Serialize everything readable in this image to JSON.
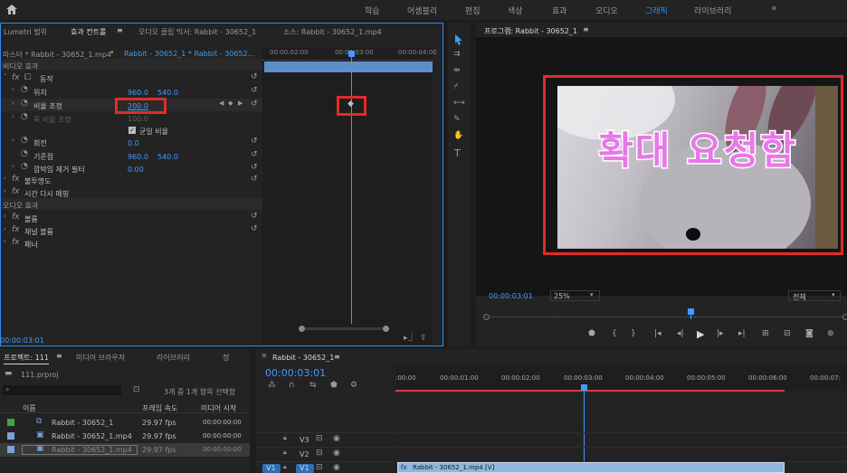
{
  "topbar": {
    "workspaces": [
      "학습",
      "어셈블리",
      "편집",
      "색상",
      "효과",
      "오디오",
      "그래픽",
      "라이브러리"
    ],
    "active": "그래픽",
    "more": "»"
  },
  "effect_panel": {
    "tabs": [
      "Lumetri 범위",
      "효과 컨트롤",
      "오디오 클립 믹서: Rabbit - 30652_1",
      "소스: Rabbit - 30652_1.mp4"
    ],
    "menu_glyph": "≡",
    "master_label": "마스터 * Rabbit - 30652_1.mp4",
    "clip_label": "Rabbit - 30652_1 * Rabbit - 30652...",
    "video_effects": "비디오 효과",
    "motion": "동작",
    "position": {
      "label": "위치",
      "x": "960.0",
      "y": "540.0"
    },
    "scale": {
      "label": "비율 조정",
      "value": "200.0"
    },
    "scale_width": {
      "label": "폭 비율 조정",
      "value": "100.0"
    },
    "uniform_scale": "균일 비율",
    "rotation": {
      "label": "회전",
      "value": "0.0"
    },
    "anchor": {
      "label": "기준점",
      "x": "960.0",
      "y": "540.0"
    },
    "anti_flicker": {
      "label": "깜박임 제거 필터",
      "value": "0.00"
    },
    "opacity": "불투명도",
    "time_remap": "시간 다시 매핑",
    "audio_effects": "오디오 효과",
    "volume": "볼륨",
    "channel_volume": "채널 볼륨",
    "panner": "패너",
    "timecodes": [
      "00:00:02:00",
      "00:00:03:00",
      "00:00:04:00"
    ],
    "current_time": "00:00:03:01"
  },
  "program_monitor": {
    "title": "프로그램: Rabbit - 30652_1",
    "menu_glyph": "≡",
    "overlay_text": "확대 요청함",
    "timecode": "00:00:03:01",
    "zoom": "25%",
    "quality": "전체"
  },
  "project_panel": {
    "tabs": [
      "프로젝트: 111",
      "미디어 브라우저",
      "라이브러리",
      "정"
    ],
    "file": "111.prproj",
    "selection_info": "3개 중 1개 항목 선택함",
    "columns": [
      "이름",
      "프레임 속도",
      "미디어 시작"
    ],
    "rows": [
      {
        "name": "Rabbit - 30652_1",
        "fps": "29.97 fps",
        "start": "00:00:00:00",
        "color": "#3ea63e"
      },
      {
        "name": "Rabbit - 30652_1.mp4",
        "fps": "29.97 fps",
        "start": "00:00:00:00",
        "color": "#7aa2d6"
      },
      {
        "name": "Rabbit - 30652_1.mp4",
        "fps": "29.97 fps",
        "start": "00:00:00:00",
        "color": "#7aa2d6"
      }
    ]
  },
  "timeline": {
    "tab": "Rabbit - 30652_1",
    "menu_glyph": "≡",
    "timecode": "00:00:03:01",
    "ruler": [
      ":00:00",
      "00:00:01:00",
      "00:00:02:00",
      "00:00:03:00",
      "00:00:04:00",
      "00:00:05:00",
      "00:00:06:00",
      "00:00:07:"
    ],
    "tracks": [
      "V3",
      "V2",
      "V1"
    ],
    "source_patch": "V1",
    "clip_label": "Rabbit - 30652_1.mp4 [V]"
  },
  "colors": {
    "accent": "#2d8ceb",
    "highlight": "#e02b2b",
    "title_text": "#e878e8"
  }
}
